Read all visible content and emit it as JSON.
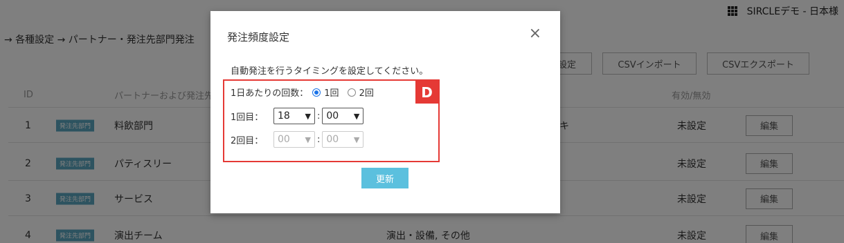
{
  "topbar": {
    "user": "SIRCLEデモ - 日本様"
  },
  "breadcrumb": "→ 各種設定 → パートナー・発注先部門発注",
  "toolbar": {
    "freq_btn": "度設定",
    "csv_import": "CSVインポート",
    "csv_export": "CSVエクスポート"
  },
  "table": {
    "headers": {
      "id": "ID",
      "name": "パートナーおよび発注先",
      "status": "有効/無効"
    },
    "rows": [
      {
        "id": "1",
        "tag": "発注先部門",
        "name": "料飲部門",
        "category": "キ",
        "status": "未設定",
        "edit": "編集"
      },
      {
        "id": "2",
        "tag": "発注先部門",
        "name": "パティスリー",
        "category": "",
        "status": "未設定",
        "edit": "編集"
      },
      {
        "id": "3",
        "tag": "発注先部門",
        "name": "サービス",
        "category": "",
        "status": "未設定",
        "edit": "編集"
      },
      {
        "id": "4",
        "tag": "発注先部門",
        "name": "演出チーム",
        "category": "演出・設備, その他",
        "status": "未設定",
        "edit": "編集"
      }
    ]
  },
  "modal": {
    "title": "発注頻度設定",
    "close": "×",
    "description": "自動発注を行うタイミングを設定してください。",
    "count_label": "1日あたりの回数：",
    "option1": "1回",
    "option2": "2回",
    "selected_count": "1回",
    "time1_label": "1回目：",
    "time1_hour": "18",
    "time1_min": "00",
    "time2_label": "2回目：",
    "time2_hour": "00",
    "time2_min": "00",
    "colon": ":",
    "badge": "D",
    "update": "更新"
  },
  "colors": {
    "highlight": "#e53935",
    "update_button": "#5bc0de",
    "tag": "#5aa7c0",
    "radio": "#1a73e8"
  }
}
